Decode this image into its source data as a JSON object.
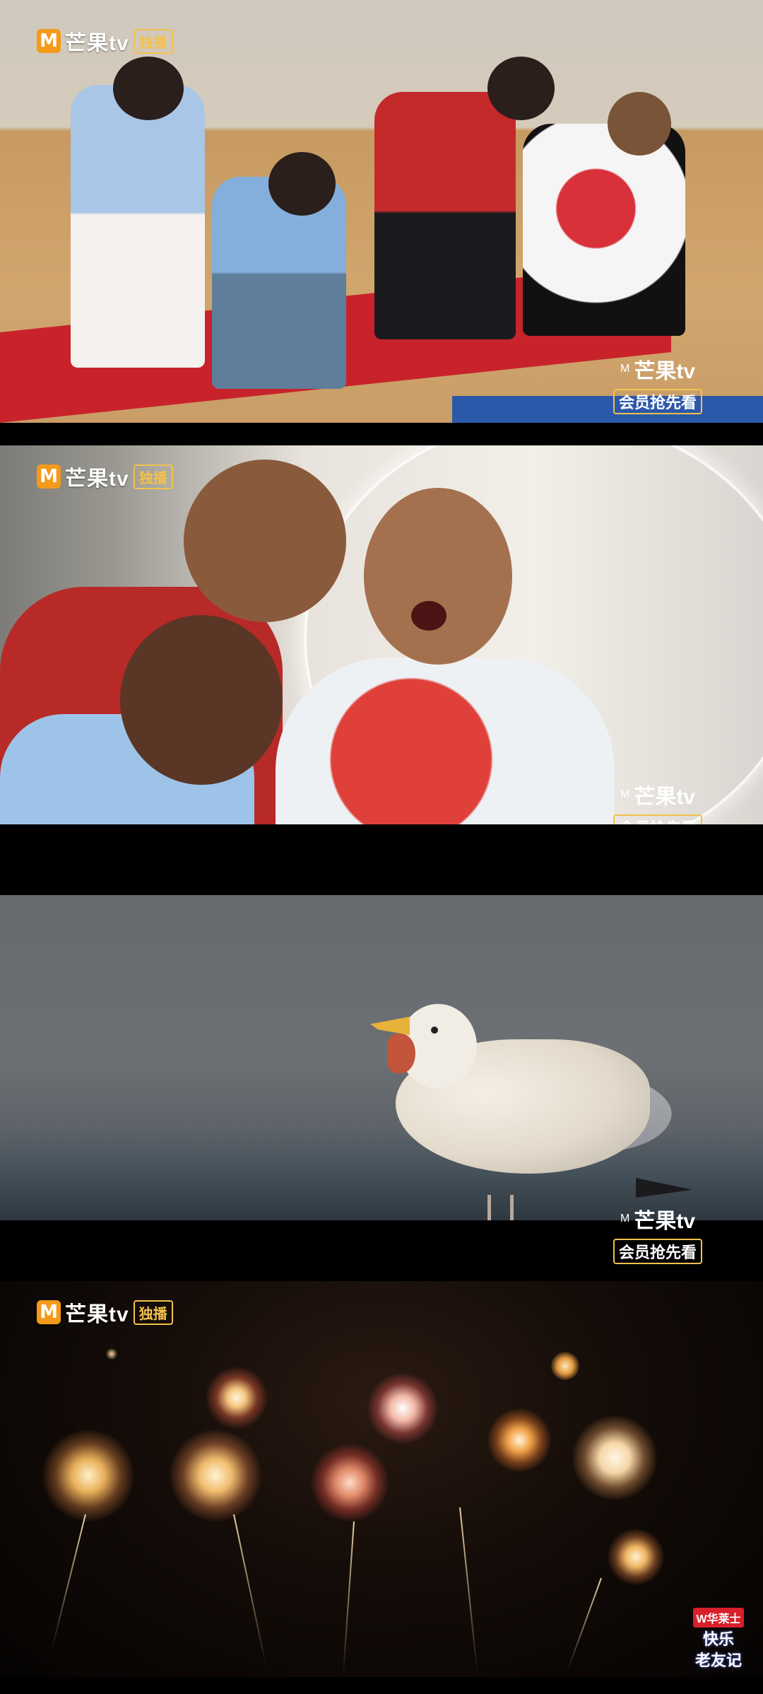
{
  "panels": [
    {
      "logo_top": {
        "brand": "芒果tv",
        "tag": "独播"
      },
      "logo_bottom": {
        "brand": "芒果tv",
        "sub": "会员抢先看"
      }
    },
    {
      "logo_top": {
        "brand": "芒果tv",
        "tag": "独播"
      },
      "logo_bottom": {
        "brand": "芒果tv",
        "sub": "会员抢先看"
      }
    },
    {
      "logo_bottom": {
        "brand": "芒果tv",
        "sub": "会员抢先看"
      }
    },
    {
      "logo_top": {
        "brand": "芒果tv",
        "tag": "独播"
      }
    }
  ],
  "badge": {
    "sponsor": "W华莱士",
    "title_1": "快乐",
    "title_2": "老友记"
  },
  "icons": {
    "logo_mark": "mango-tv-logo-icon",
    "logo_char": "M"
  },
  "colors": {
    "mango_orange": "#f39a1b",
    "gold": "#f2c14e",
    "mat_red": "#c8232b"
  }
}
